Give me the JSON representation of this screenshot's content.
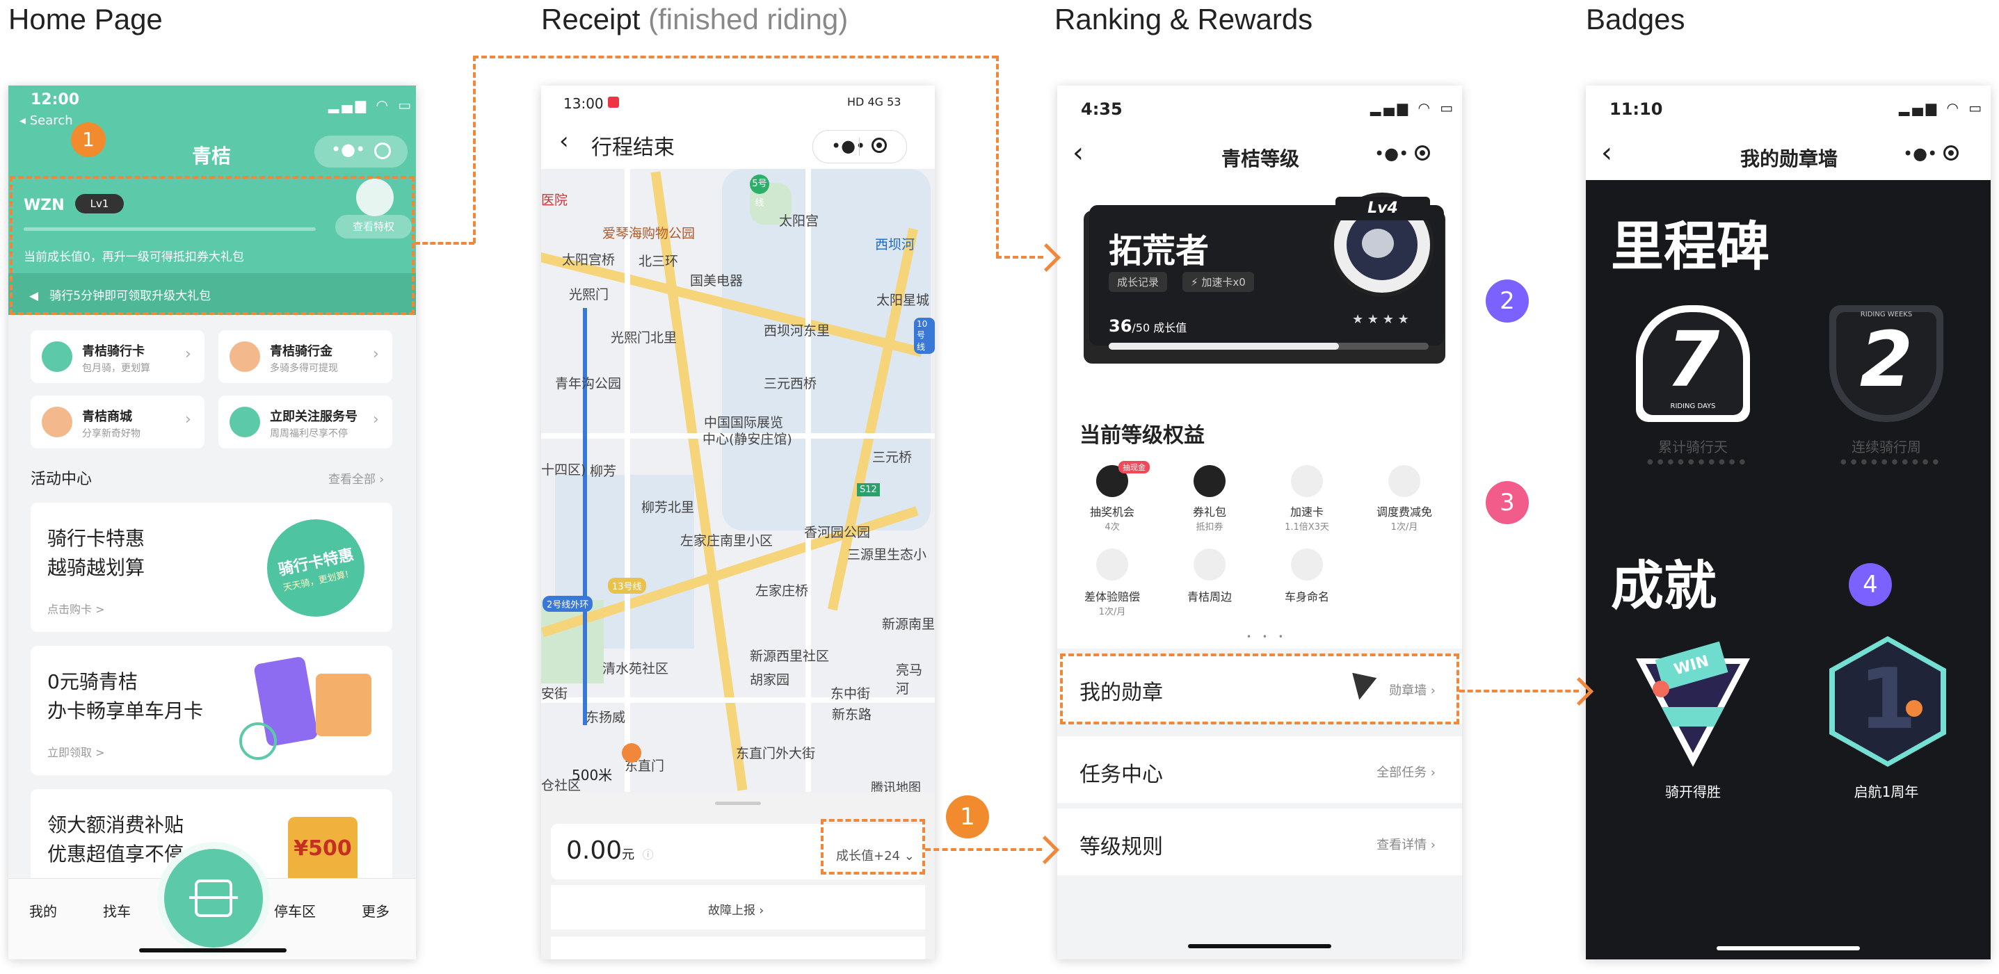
{
  "columns": {
    "home": "Home Page",
    "receipt_main": "Receipt",
    "receipt_sub": "(finished riding)",
    "ranking": "Ranking & Rewards",
    "badges": "Badges"
  },
  "colors": {
    "accent_orange": "#f0873a",
    "brand_green": "#5ccaa8",
    "purple": "#7b61ff",
    "pink": "#f25c8a"
  },
  "markers": {
    "one": "1",
    "two": "2",
    "three": "3",
    "four": "4"
  },
  "home": {
    "time": "12:00",
    "back": "◂ Search",
    "title": "青桔",
    "user": "WZN",
    "level": "Lv1",
    "privilege_btn": "查看特权",
    "growth_text": "当前成长值0，再升一级可得抵扣券大礼包",
    "banner": "骑行5分钟即可领取升级大礼包",
    "tiles": [
      {
        "title": "青桔骑行卡",
        "sub": "包月骑，更划算"
      },
      {
        "title": "青桔骑行金",
        "sub": "多骑多得可提现"
      },
      {
        "title": "青桔商城",
        "sub": "分享新奇好物"
      },
      {
        "title": "立即关注服务号",
        "sub": "周周福利尽享不停"
      }
    ],
    "activity_title": "活动中心",
    "activity_all": "查看全部",
    "promos": [
      {
        "l1": "骑行卡特惠",
        "l2": "越骑越划算",
        "link": "点击购卡 >"
      },
      {
        "l1": "0元骑青桔",
        "l2": "办卡畅享单车月卡",
        "link": "立即领取 >"
      },
      {
        "l1": "领大额消费补贴",
        "l2": "优惠超值享不停",
        "link": ""
      }
    ],
    "promo1_art": "骑行卡特惠",
    "promo1_art_sub": "天天骑，更划算!",
    "promo3_art": "¥500",
    "tabs": [
      "我的",
      "找车",
      "停车区",
      "更多"
    ]
  },
  "receipt": {
    "time": "13:00",
    "status_right": "HD 4G 53",
    "title": "行程结束",
    "map_labels": [
      "医院",
      "爱琴海购物公园",
      "太阳宫",
      "西坝河",
      "太阳宫桥",
      "北三环",
      "国美电器",
      "光熙门",
      "光熙门北里",
      "西坝河东里",
      "太阳星城",
      "青年沟公园",
      "三元西桥",
      "中国国际展览",
      "中心(静安庄馆)",
      "三元桥",
      "柳芳",
      "柳芳北里",
      "香河园公园",
      "左家庄南里小区",
      "三源里生态小",
      "左家庄桥",
      "新源西里社区",
      "新源南里",
      "清水苑社区",
      "胡家园",
      "东中街",
      "东直门",
      "东直门外大街",
      "安街",
      "东扬威",
      "新东路",
      "十四区)",
      "5号线",
      "2号线外环",
      "13号线",
      "10号线",
      "S12",
      "亮马河",
      "仓社区"
    ],
    "scale": "500米",
    "map_brand": "腾讯地图",
    "amount": "0.00",
    "unit": "元",
    "growth": "成长值+24",
    "report": "故障上报"
  },
  "rank": {
    "time": "4:35",
    "title": "青桔等级",
    "card_title": "拓荒者",
    "record_tag": "成长记录",
    "speed_tag": "加速卡x0",
    "lv": "Lv4",
    "progress": "36",
    "progress_total": "/50 成长值",
    "progress_fraction": 0.72,
    "stars": "★ ★ ★ ★",
    "rights_title": "当前等级权益",
    "rights": [
      {
        "label": "抽奖机会",
        "sub": "4次",
        "tag": "抽现金"
      },
      {
        "label": "券礼包",
        "sub": "抵扣券"
      },
      {
        "label": "加速卡",
        "sub": "1.1倍X3天"
      },
      {
        "label": "调度费减免",
        "sub": "1次/月"
      },
      {
        "label": "差体验赔偿",
        "sub": "1次/月"
      },
      {
        "label": "青桔周边",
        "sub": ""
      },
      {
        "label": "车身命名",
        "sub": ""
      }
    ],
    "menu": [
      {
        "label": "我的勋章",
        "right": "勋章墙"
      },
      {
        "label": "任务中心",
        "right": "全部任务"
      },
      {
        "label": "等级规则",
        "right": "查看详情"
      }
    ]
  },
  "badges": {
    "time": "11:10",
    "title": "我的勋章墙",
    "milestone": "里程碑",
    "achievement": "成就",
    "m1_num": "7",
    "m1_top": "",
    "m1_bottom": "RIDING DAYS",
    "m1_label": "累计骑行天",
    "m2_num": "2",
    "m2_top": "RIDING WEEKS",
    "m2_label": "连续骑行周",
    "a1_flag": "WIN",
    "a1_label": "骑开得胜",
    "a2_num": "1",
    "a2_label": "启航1周年"
  }
}
